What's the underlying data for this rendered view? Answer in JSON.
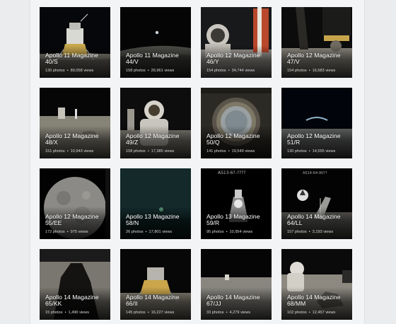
{
  "albums": [
    {
      "line1": "Apollo 11 Magazine",
      "line2": "40/S",
      "photos": "130 photos",
      "views": "89,058 views",
      "scene": "lander-night"
    },
    {
      "line1": "Apollo 11 Magazine",
      "line2": "44/V",
      "photos": "158 photos",
      "views": "26,961 views",
      "scene": "earthrise"
    },
    {
      "line1": "Apollo 12 Magazine",
      "line2": "46/Y",
      "photos": "154 photos",
      "views": "34,744 views",
      "scene": "astronaut-flag"
    },
    {
      "line1": "Apollo 12 Magazine",
      "line2": "47/V",
      "photos": "154 photos",
      "views": "16,583 views",
      "scene": "lander-leg"
    },
    {
      "line1": "Apollo 12 Magazine",
      "line2": "48/X",
      "photos": "151 photos",
      "views": "10,943 views",
      "scene": "surface-gear"
    },
    {
      "line1": "Apollo 12 Magazine",
      "line2": "49/Z",
      "photos": "158 photos",
      "views": "17,385 views",
      "scene": "astronaut-closeup"
    },
    {
      "line1": "Apollo 12 Magazine",
      "line2": "50/Q",
      "photos": "141 photos",
      "views": "19,549 views",
      "scene": "porthole"
    },
    {
      "line1": "Apollo 12 Magazine",
      "line2": "51/R",
      "photos": "130 photos",
      "views": "14,555 views",
      "scene": "earth-crescent"
    },
    {
      "line1": "Apollo 12 Magazine",
      "line2": "55/EE",
      "photos": "172 photos",
      "views": "975 views",
      "scene": "moon-full"
    },
    {
      "line1": "Apollo 13 Magazine",
      "line2": "58/N",
      "photos": "26 photos",
      "views": "17,801 views",
      "scene": "dark-teal"
    },
    {
      "line1": "Apollo 13 Magazine",
      "line2": "59/R",
      "photos": "95 photos",
      "views": "10,954 views",
      "scene": "spacecraft"
    },
    {
      "line1": "Apollo 14 Magazine",
      "line2": "64/LL",
      "photos": "157 photos",
      "views": "3,193 views",
      "scene": "antenna"
    },
    {
      "line1": "Apollo 14 Magazine",
      "line2": "65/KK",
      "photos": "15 photos",
      "views": "1,490 views",
      "scene": "shadow-lander"
    },
    {
      "line1": "Apollo 14 Magazine",
      "line2": "66/II",
      "photos": "145 photos",
      "views": "16,227 views",
      "scene": "lander-day"
    },
    {
      "line1": "Apollo 14 Magazine",
      "line2": "67/JJ",
      "photos": "33 photos",
      "views": "4,279 views",
      "scene": "surface-flat"
    },
    {
      "line1": "Apollo 14 Magazine",
      "line2": "68/MM",
      "photos": "102 photos",
      "views": "12,457 views",
      "scene": "astronaut-rocks"
    }
  ],
  "meta_separator": "•"
}
